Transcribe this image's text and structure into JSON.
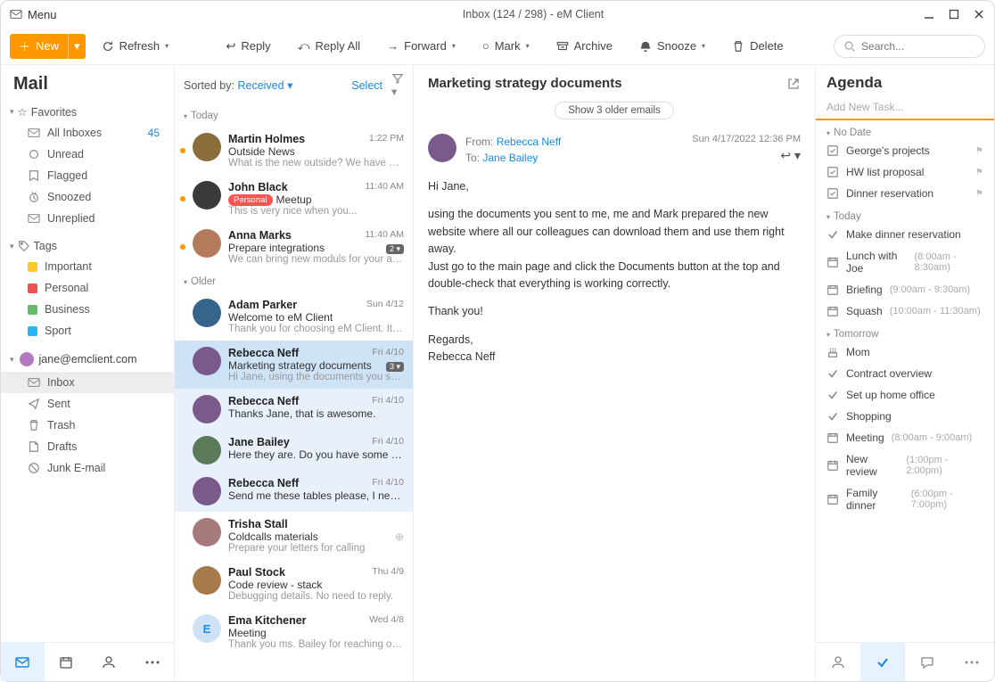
{
  "titlebar": {
    "menu": "Menu",
    "title": "Inbox (124 / 298) - eM Client"
  },
  "toolbar": {
    "new": "New",
    "refresh": "Refresh",
    "reply": "Reply",
    "replyall": "Reply All",
    "forward": "Forward",
    "mark": "Mark",
    "archive": "Archive",
    "snooze": "Snooze",
    "delete": "Delete",
    "search_ph": "Search..."
  },
  "sidebar": {
    "title": "Mail",
    "favorites_label": "Favorites",
    "favorites": [
      {
        "label": "All Inboxes",
        "count": "45"
      },
      {
        "label": "Unread"
      },
      {
        "label": "Flagged"
      },
      {
        "label": "Snoozed"
      },
      {
        "label": "Unreplied"
      }
    ],
    "tags_label": "Tags",
    "tags": [
      {
        "label": "Important",
        "color": "#ffca28"
      },
      {
        "label": "Personal",
        "color": "#ef5350"
      },
      {
        "label": "Business",
        "color": "#66bb6a"
      },
      {
        "label": "Sport",
        "color": "#29b6f6"
      }
    ],
    "account": "jane@emclient.com",
    "folders": [
      {
        "label": "Inbox",
        "selected": true
      },
      {
        "label": "Sent"
      },
      {
        "label": "Trash"
      },
      {
        "label": "Drafts"
      },
      {
        "label": "Junk E-mail"
      }
    ]
  },
  "msglist": {
    "sortlabel": "Sorted by:",
    "sortval": "Received",
    "select": "Select",
    "groups": [
      "Today",
      "Older"
    ],
    "today": [
      {
        "sender": "Martin Holmes",
        "subject": "Outside News",
        "preview": "What is the new outside? We have be...",
        "time": "1:22 PM",
        "unread": true,
        "avatar": "c1"
      },
      {
        "sender": "John Black",
        "subject": "Meetup",
        "preview": "This is very nice when you...",
        "time": "11:40 AM",
        "unread": true,
        "avatar": "c2",
        "pill": "Personal"
      },
      {
        "sender": "Anna Marks",
        "subject": "Prepare integrations",
        "preview": "We can bring new moduls for your app...",
        "time": "11:40 AM",
        "unread": true,
        "avatar": "c3",
        "badge": "2"
      }
    ],
    "older": [
      {
        "sender": "Adam Parker",
        "subject": "Welcome to eM Client",
        "preview": "Thank you for choosing eM Client. It's...",
        "time": "Sun 4/12",
        "avatar": "c4"
      },
      {
        "sender": "Rebecca Neff",
        "subject": "Marketing strategy documents",
        "preview": "Hi Jane, using the documents you sent...",
        "time": "Fri 4/10",
        "avatar": "c5",
        "selected": true,
        "badge": "3"
      },
      {
        "sender": "Rebecca Neff",
        "subject": "Thanks Jane, that is awesome.",
        "preview": "",
        "time": "Fri 4/10",
        "avatar": "c5",
        "thread": true
      },
      {
        "sender": "Jane Bailey",
        "subject": "Here they are. Do you have some m...",
        "preview": "",
        "time": "Fri 4/10",
        "avatar": "c6",
        "thread": true
      },
      {
        "sender": "Rebecca Neff",
        "subject": "Send me these tables please, I need...",
        "preview": "",
        "time": "Fri 4/10",
        "avatar": "c5",
        "thread": true
      },
      {
        "sender": "Trisha Stall",
        "subject": "Coldcalls materials",
        "preview": "Prepare your letters for calling",
        "time": "",
        "avatar": "c7",
        "target": true
      },
      {
        "sender": "Paul Stock",
        "subject": "Code review - stack",
        "preview": "Debugging details. No need to reply.",
        "time": "Thu 4/9",
        "avatar": "c8"
      },
      {
        "sender": "Ema Kitchener",
        "subject": "Meeting",
        "preview": "Thank you ms. Bailey for reaching out...",
        "time": "Wed 4/8",
        "avatar": "c9",
        "initial": "E"
      }
    ]
  },
  "reader": {
    "subject": "Marketing strategy documents",
    "older": "Show 3 older emails",
    "from_lbl": "From:",
    "from": "Rebecca Neff",
    "to_lbl": "To:",
    "to": "Jane Bailey",
    "date": "Sun 4/17/2022 12:36 PM",
    "body": {
      "p1": "Hi Jane,",
      "p2": "using the documents you sent to me, me and Mark prepared the new website where all our colleagues can download them and use them right away.",
      "p3": "Just go to the main page and click the Documents button at the top and double-check that everything is working correctly.",
      "p4": "Thank you!",
      "p5": "Regards,",
      "p6": "Rebecca Neff"
    }
  },
  "agenda": {
    "title": "Agenda",
    "addtask": "Add New Task...",
    "sections": {
      "nodate": "No Date",
      "today": "Today",
      "tomorrow": "Tomorrow"
    },
    "nodate": [
      {
        "icon": "task",
        "label": "George's projects",
        "flag": true
      },
      {
        "icon": "task",
        "label": "HW list proposal",
        "flag": true
      },
      {
        "icon": "task",
        "label": "Dinner reservation",
        "flag": true
      }
    ],
    "today": [
      {
        "icon": "check",
        "label": "Make dinner reservation"
      },
      {
        "icon": "cal",
        "label": "Lunch with Joe",
        "time": "(8:00am - 8:30am)"
      },
      {
        "icon": "cal",
        "label": "Briefing",
        "time": "(9:00am - 9:30am)"
      },
      {
        "icon": "cal",
        "label": "Squash",
        "time": "(10:00am - 11:30am)"
      }
    ],
    "tomorrow": [
      {
        "icon": "bday",
        "label": "Mom"
      },
      {
        "icon": "check",
        "label": "Contract overview"
      },
      {
        "icon": "check",
        "label": "Set up home office"
      },
      {
        "icon": "check",
        "label": "Shopping"
      },
      {
        "icon": "cal",
        "label": "Meeting",
        "time": "(8:00am - 9:00am)"
      },
      {
        "icon": "cal",
        "label": "New review",
        "time": "(1:00pm - 2:00pm)"
      },
      {
        "icon": "cal",
        "label": "Family dinner",
        "time": "(6:00pm - 7:00pm)"
      }
    ]
  }
}
